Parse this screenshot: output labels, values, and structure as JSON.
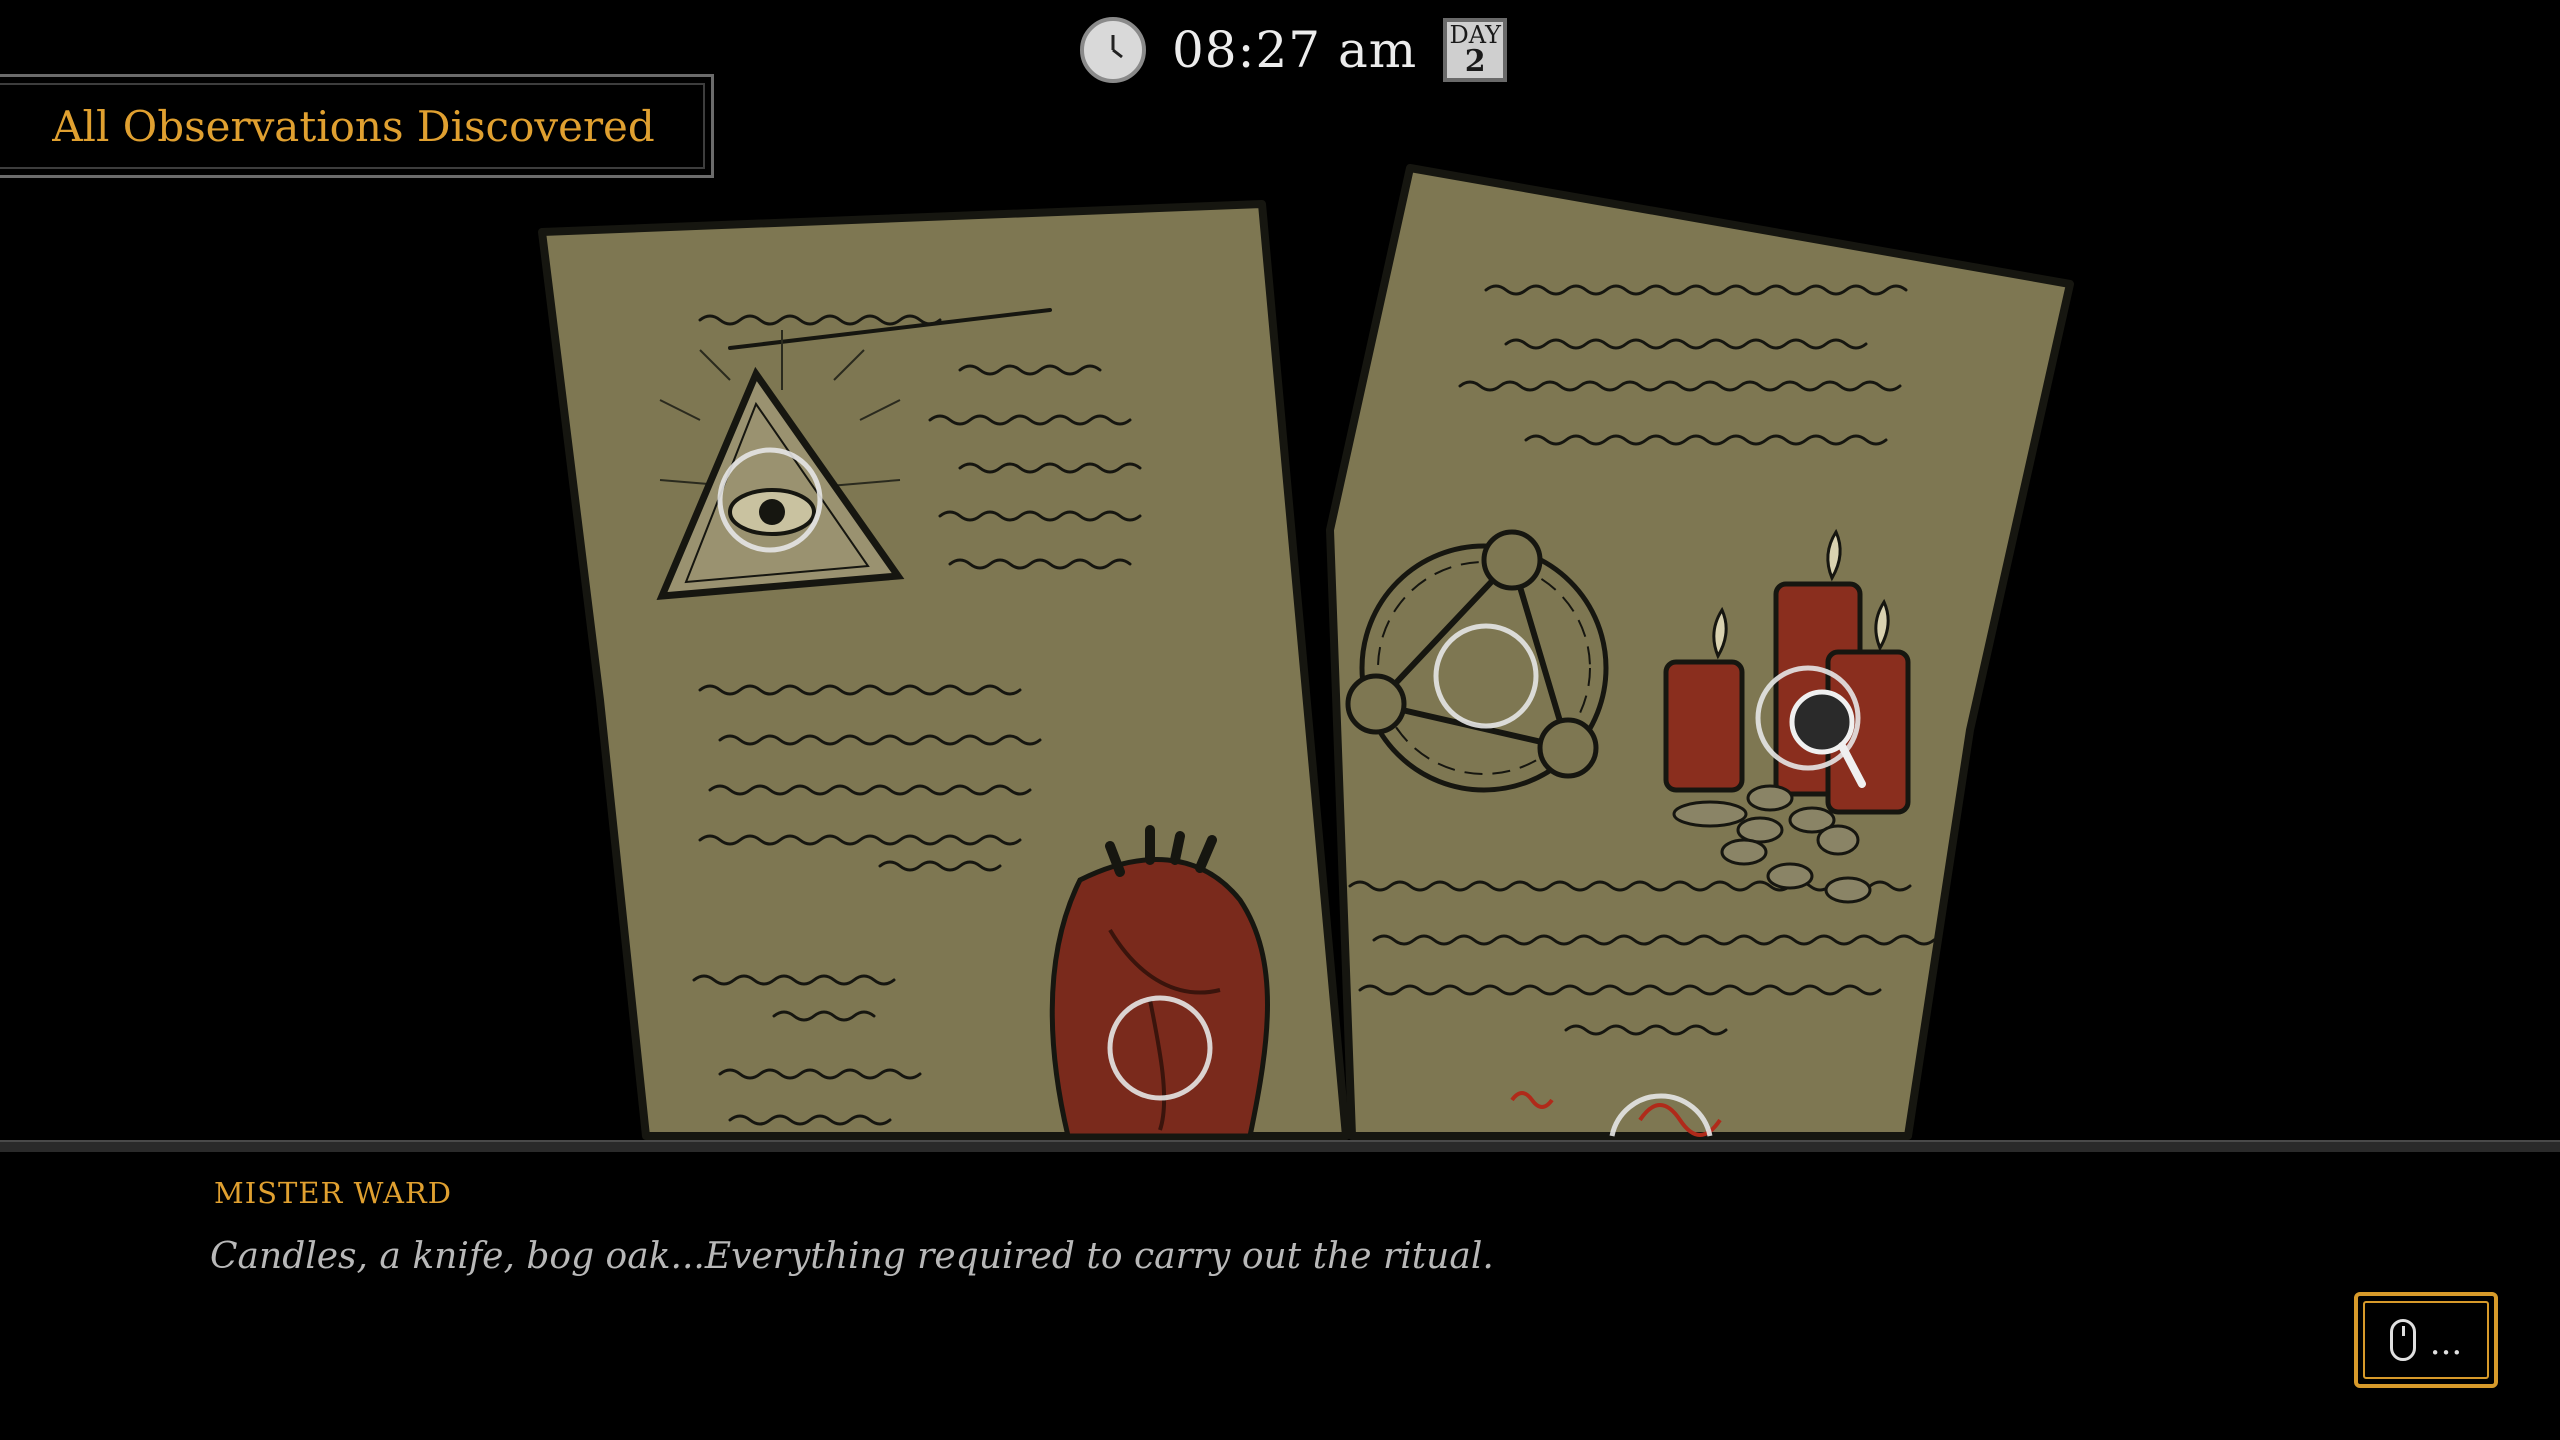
{
  "hud": {
    "time": "08:27 am",
    "day_label": "DAY",
    "day_number": "2",
    "clock_icon": "clock-icon"
  },
  "banner": {
    "text": "All Observations Discovered"
  },
  "dialogue": {
    "speaker": "MISTER WARD",
    "line": "Candles, a knife, bog oak...Everything required to carry out the ritual."
  },
  "continue_button": {
    "icon": "mouse-icon",
    "text": "..."
  },
  "colors": {
    "accent": "#e0a030",
    "paper": "#7e7752",
    "ink": "#161610",
    "blood": "#7a2a1c"
  }
}
